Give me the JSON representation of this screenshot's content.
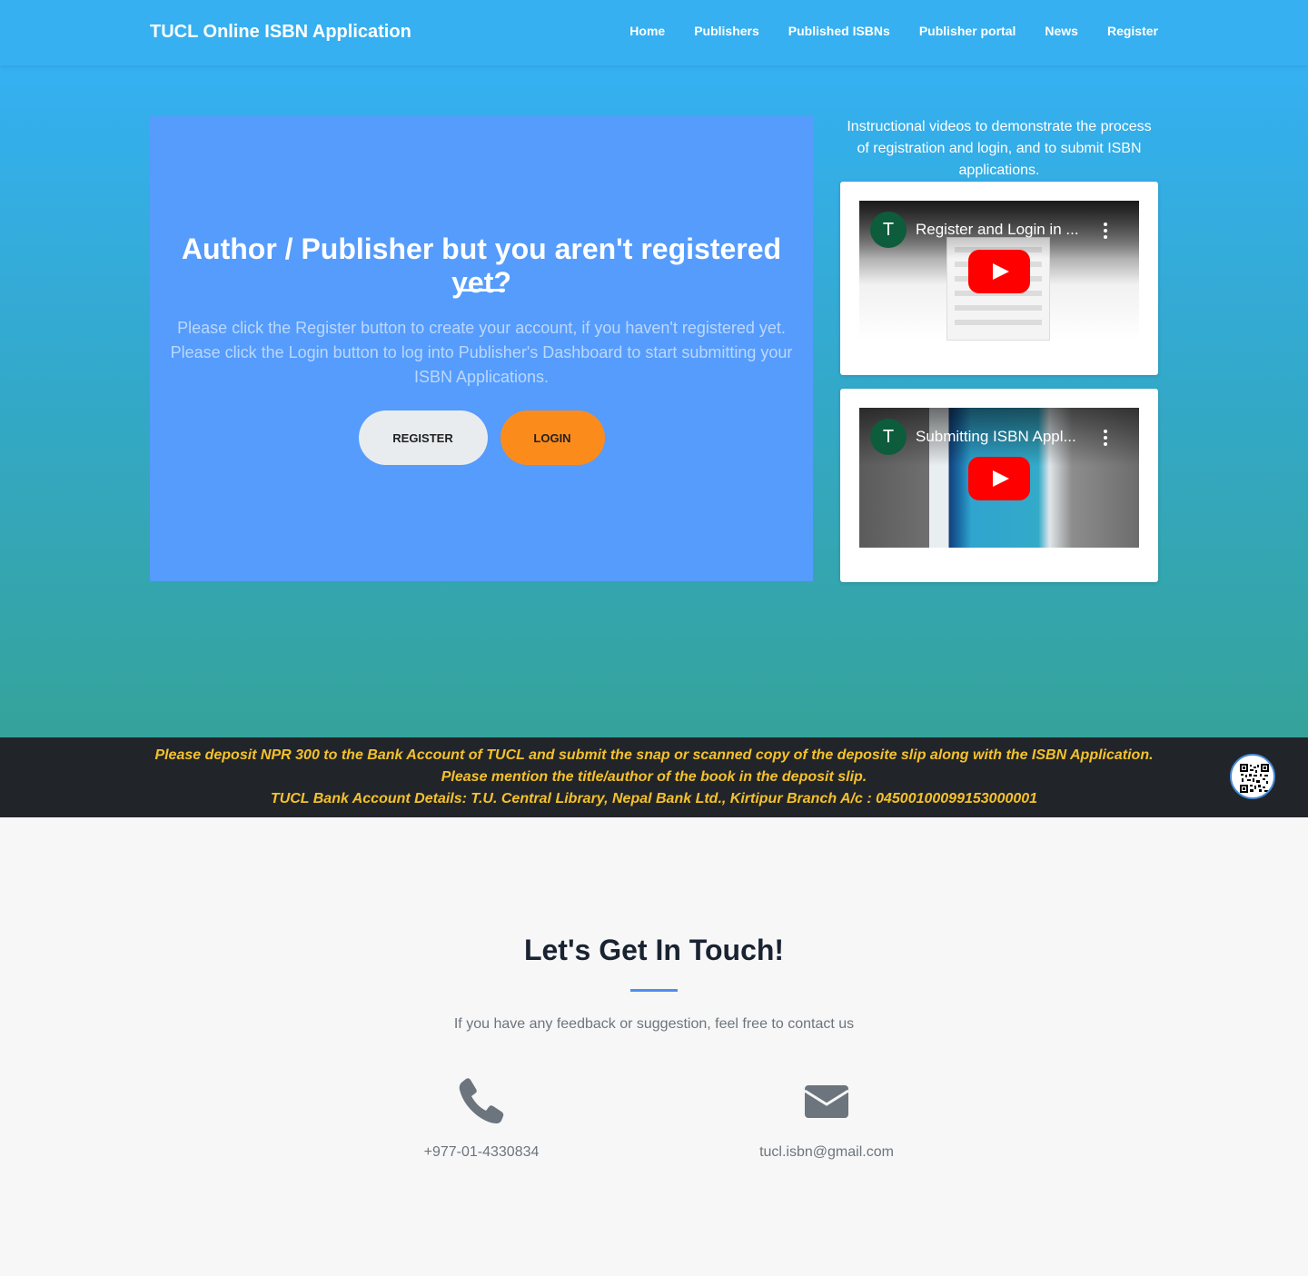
{
  "header": {
    "brand": "TUCL Online ISBN Application",
    "nav": [
      "Home",
      "Publishers",
      "Published ISBNs",
      "Publisher portal",
      "News",
      "Register"
    ]
  },
  "hero": {
    "title": "Author / Publisher but you aren't registered yet?",
    "text": "Please click the Register button to create your account, if you haven't registered yet. Please click the Login button to log into Publisher's Dashboard to start submitting your ISBN Applications.",
    "register_label": "REGISTER",
    "login_label": "LOGIN"
  },
  "videos": {
    "intro": "Instructional videos to demonstrate the process of registration and login, and to submit ISBN applications.",
    "items": [
      {
        "avatar": "T",
        "title": "Register and Login in ..."
      },
      {
        "avatar": "T",
        "title": "Submitting ISBN Appl..."
      }
    ]
  },
  "notice": {
    "line1": "Please deposit NPR 300 to the Bank Account of TUCL and submit the snap or scanned copy of the deposite slip along with the ISBN Application.",
    "line2": "Please mention the title/author of the book in the deposit slip.",
    "line3": "TUCL Bank Account Details: T.U. Central Library, Nepal Bank Ltd., Kirtipur Branch A/c : 04500100099153000001"
  },
  "contact": {
    "title": "Let's Get In Touch!",
    "subtitle": "If you have any feedback or suggestion, feel free to contact us",
    "phone": "+977-01-4330834",
    "email": "tucl.isbn@gmail.com"
  },
  "colors": {
    "navbar": "#36b0f0",
    "hero_card": "#559cfc",
    "login_button": "#fb8c1c",
    "notice_bg": "#212529",
    "notice_text": "#f5c12c",
    "accent_divider": "#4e8ef0"
  },
  "icons": [
    "phone-icon",
    "envelope-icon",
    "qr-code-icon",
    "youtube-play-icon"
  ]
}
